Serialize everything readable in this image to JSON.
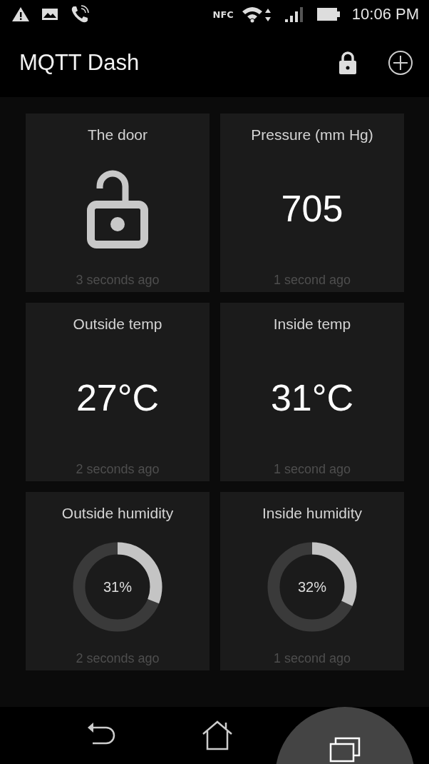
{
  "status_bar": {
    "nfc": "NFC",
    "time": "10:06 PM"
  },
  "app_bar": {
    "title": "MQTT Dash",
    "locked": true
  },
  "tiles": [
    {
      "kind": "lock",
      "title": "The door",
      "locked": false,
      "updated": "3 seconds ago"
    },
    {
      "kind": "text",
      "title": "Pressure (mm Hg)",
      "value": "705",
      "updated": "1 second ago"
    },
    {
      "kind": "text",
      "title": "Outside temp",
      "value": "27°C",
      "updated": "2 seconds ago"
    },
    {
      "kind": "text",
      "title": "Inside temp",
      "value": "31°C",
      "updated": "1 second ago"
    },
    {
      "kind": "gauge",
      "title": "Outside humidity",
      "value": "31%",
      "level": 0.31,
      "updated": "2 seconds ago"
    },
    {
      "kind": "gauge",
      "title": "Inside humidity",
      "value": "32%",
      "level": 0.32,
      "updated": "1 second ago"
    }
  ],
  "nav_buttons": [
    {
      "kind": "back",
      "pressed": false
    },
    {
      "kind": "home",
      "pressed": false
    },
    {
      "kind": "recents",
      "pressed": true
    }
  ]
}
